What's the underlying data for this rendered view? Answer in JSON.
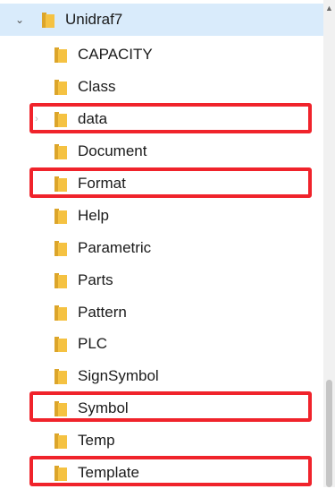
{
  "tree": {
    "root": {
      "label": "Unidraf7"
    },
    "items": [
      {
        "label": "CAPACITY"
      },
      {
        "label": "Class"
      },
      {
        "label": "data"
      },
      {
        "label": "Document"
      },
      {
        "label": "Format"
      },
      {
        "label": "Help"
      },
      {
        "label": "Parametric"
      },
      {
        "label": "Parts"
      },
      {
        "label": "Pattern"
      },
      {
        "label": "PLC"
      },
      {
        "label": "SignSymbol"
      },
      {
        "label": "Symbol"
      },
      {
        "label": "Temp"
      },
      {
        "label": "Template"
      }
    ],
    "highlighted": [
      "data",
      "Format",
      "Symbol",
      "Template"
    ]
  },
  "icons": {
    "root_toggle": "chevron-down-icon",
    "item_toggle": "chevron-right-icon",
    "folder": "folder-icon",
    "scroll_up": "scroll-up-arrow-icon"
  },
  "colors": {
    "root_selection": "#d9ebfb",
    "highlight_border": "#f0232b",
    "folder_front": "#f5c242",
    "folder_back": "#dca52a"
  }
}
